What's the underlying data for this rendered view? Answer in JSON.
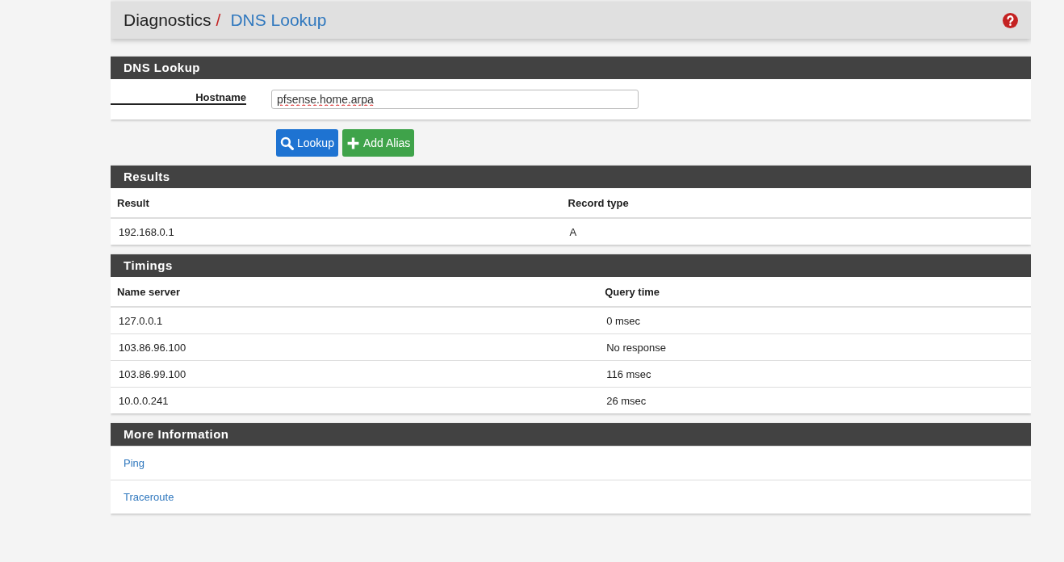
{
  "breadcrumb": {
    "parent": "Diagnostics",
    "separator": "/",
    "current": "DNS Lookup"
  },
  "lookup_panel": {
    "title": "DNS Lookup",
    "hostname_label": "Hostname",
    "hostname_value": "pfsense.home.arpa"
  },
  "buttons": [
    {
      "kind": "search",
      "label": "Lookup"
    },
    {
      "kind": "add",
      "label": "Add Alias"
    }
  ],
  "results": {
    "title": "Results",
    "columns": [
      "Result",
      "Record type"
    ],
    "rows": [
      [
        "192.168.0.1",
        "A"
      ]
    ]
  },
  "timings": {
    "title": "Timings",
    "columns": [
      "Name server",
      "Query time"
    ],
    "rows": [
      [
        "127.0.0.1",
        "0 msec"
      ],
      [
        "103.86.96.100",
        "No response"
      ],
      [
        "103.86.99.100",
        "116 msec"
      ],
      [
        "10.0.0.241",
        "26 msec"
      ]
    ]
  },
  "more_information": {
    "title": "More Information",
    "links": [
      "Ping",
      "Traceroute"
    ]
  }
}
